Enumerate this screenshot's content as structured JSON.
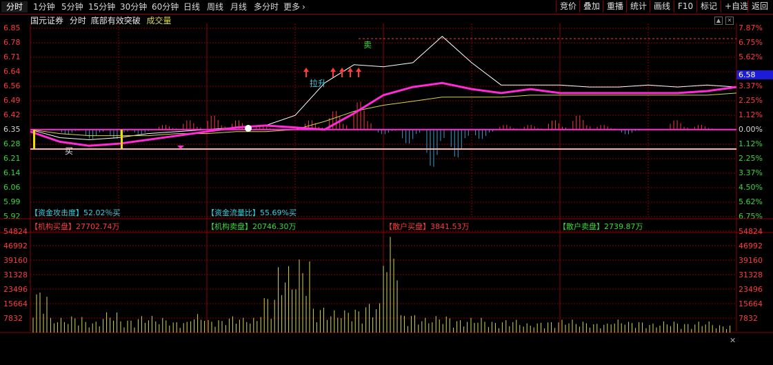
{
  "toolbar": {
    "tabs": [
      "分时",
      "1分钟",
      "5分钟",
      "15分钟",
      "30分钟",
      "60分钟",
      "日线",
      "周线",
      "月线",
      "多分时",
      "更多"
    ],
    "more_icon": "chevron-right-icon",
    "right_buttons": [
      "竞价",
      "叠加",
      "重播",
      "统计",
      "画线",
      "F10",
      "标记",
      "+自选",
      "返回"
    ]
  },
  "header": {
    "stock_name": "国元证券",
    "view": "分时",
    "indicator": "底部有效突破",
    "volume_label": "成交量",
    "icons": [
      "up-arrow-icon",
      "close-icon"
    ]
  },
  "price_axis": {
    "left": [
      "6.85",
      "6.78",
      "6.71",
      "6.64",
      "6.56",
      "6.49",
      "6.42",
      "6.35",
      "6.28",
      "6.21",
      "6.14",
      "6.06",
      "5.99",
      "5.92"
    ],
    "right": [
      "7.87%",
      "6.75%",
      "5.62%",
      "4.50%",
      "3.37%",
      "2.25%",
      "1.12%",
      "0.00%",
      "1.12%",
      "2.25%",
      "3.37%",
      "4.50%",
      "5.62%",
      "6.75%"
    ],
    "current_price": "6.58"
  },
  "annotations": {
    "buy_label": "买",
    "sell_label": "卖",
    "pull_label": "拉升"
  },
  "stats": {
    "attack_label": "【资金攻击度】",
    "attack_value": "52.02％买",
    "flow_label": "【资金流量比】",
    "flow_value": "55.69%买",
    "inst_buy_label": "【机构买盘】",
    "inst_buy_value": "27702.74万",
    "inst_sell_label": "【机构卖盘】",
    "inst_sell_value": "20746.30万",
    "retail_buy_label": "【散户买盘】",
    "retail_buy_value": "3841.53万",
    "retail_sell_label": "【散户卖盘】",
    "retail_sell_value": "2739.87万"
  },
  "volume_axis": [
    "54824",
    "46992",
    "39160",
    "31328",
    "23496",
    "15664",
    "7832"
  ],
  "colors": {
    "up": "#ff3b3b",
    "down": "#3bd63b",
    "grid": "#8b0000",
    "price_line": "#ffffff",
    "avg_line": "#d8d84a",
    "indicator_line": "#ff2ad8",
    "volume_bar": "#d8d84a",
    "badge": "#1c1cd6"
  },
  "chart_data": {
    "type": "line",
    "title": "",
    "xlabel": "",
    "ylabel": "",
    "ylim": [
      5.92,
      6.85
    ],
    "prev_close": 6.35,
    "x": [
      0,
      10,
      20,
      30,
      40,
      50,
      60,
      70,
      80,
      90,
      100,
      110,
      120,
      130,
      140,
      150,
      160,
      170,
      180,
      190,
      200,
      210,
      220,
      230,
      240
    ],
    "series": [
      {
        "values": [
          6.35,
          6.31,
          6.3,
          6.31,
          6.33,
          6.34,
          6.35,
          6.36,
          6.37,
          6.42,
          6.58,
          6.67,
          6.66,
          6.68,
          6.81,
          6.68,
          6.57,
          6.57,
          6.57,
          6.56,
          6.56,
          6.57,
          6.56,
          6.57,
          6.56
        ]
      },
      {
        "values": [
          6.35,
          6.33,
          6.32,
          6.32,
          6.32,
          6.33,
          6.33,
          6.34,
          6.34,
          6.35,
          6.39,
          6.44,
          6.47,
          6.49,
          6.51,
          6.51,
          6.51,
          6.52,
          6.52,
          6.52,
          6.52,
          6.52,
          6.52,
          6.52,
          6.53
        ]
      },
      {
        "values": [
          6.34,
          6.29,
          6.27,
          6.28,
          6.3,
          6.32,
          6.34,
          6.36,
          6.37,
          6.36,
          6.35,
          6.43,
          6.52,
          6.56,
          6.58,
          6.55,
          6.53,
          6.55,
          6.53,
          6.53,
          6.53,
          6.53,
          6.53,
          6.54,
          6.56
        ]
      }
    ],
    "macd": [
      0,
      -1,
      -2,
      -2,
      -1,
      1,
      2,
      3,
      2,
      1,
      0,
      2,
      4,
      6,
      -1,
      -3,
      -8,
      -6,
      -2,
      1,
      1,
      2,
      3,
      1,
      -1,
      0,
      2,
      1,
      0
    ],
    "volume": [
      23000,
      8000,
      9000,
      6000,
      11000,
      7000,
      9000,
      8000,
      6000,
      10000,
      7000,
      9000,
      8000,
      20000,
      36000,
      40000,
      14000,
      12000,
      13000,
      16000,
      52000,
      10000,
      8000,
      9000,
      7000,
      8000,
      6000,
      7000,
      5000,
      6000,
      7000,
      6000,
      5000,
      7000,
      6000,
      5000,
      6000,
      5000,
      6000,
      4000
    ]
  }
}
